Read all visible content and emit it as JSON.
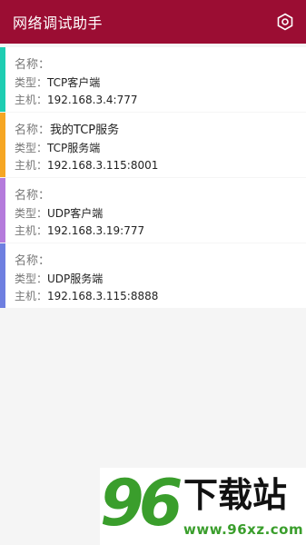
{
  "appbar": {
    "title": "网络调试助手",
    "background": "#9b0d33",
    "settings_icon": "settings-hexagon-icon"
  },
  "labels": {
    "name": "名称：",
    "type": "类型：",
    "host": "主机："
  },
  "connections": [
    {
      "name": "",
      "type": "TCP客户端",
      "host": "192.168.3.4:777",
      "color": "#1ecdb2"
    },
    {
      "name": "我的TCP服务",
      "type": "TCP服务端",
      "host": "192.168.3.115:8001",
      "color": "#f6a623"
    },
    {
      "name": "",
      "type": "UDP客户端",
      "host": "192.168.3.19:777",
      "color": "#b57bdc"
    },
    {
      "name": "",
      "type": "UDP服务端",
      "host": "192.168.3.115:8888",
      "color": "#6e7fe0"
    }
  ],
  "watermark": {
    "number": "96",
    "text": "下载站",
    "url": "www.96xz.com"
  }
}
